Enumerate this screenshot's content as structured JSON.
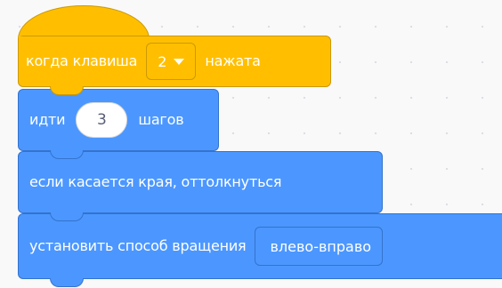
{
  "workspace": {
    "background_color": "#f9f9fa",
    "grid_dot_color": "#dcdde2"
  },
  "colors": {
    "events": "#ffbf00",
    "events_border": "#cc9900",
    "motion": "#4c97ff",
    "motion_border": "#3373cc",
    "input_bg": "#ffffff",
    "input_text": "#575e75"
  },
  "blocks": {
    "when_key_pressed": {
      "prefix": "когда клавиша",
      "key_value": "2",
      "dropdown_icon": "chevron-down-icon",
      "suffix": "нажата"
    },
    "move_steps": {
      "prefix": "идти",
      "steps_value": "3",
      "suffix": "шагов"
    },
    "bounce": {
      "label": "если касается края, оттолкнуться"
    },
    "set_rotation_style": {
      "label": "установить способ вращения",
      "style_value": "влево-вправо"
    }
  }
}
